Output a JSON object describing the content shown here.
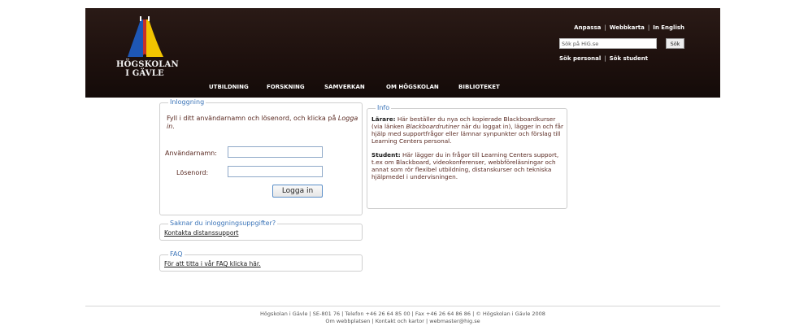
{
  "header": {
    "logo_text_line1": "HÖGSKOLAN",
    "logo_text_line2": "I GÄVLE",
    "top_links": [
      "Anpassa",
      "Webbkarta",
      "In English"
    ],
    "search": {
      "value": "Sök på HiG.se",
      "button_label": "Sök"
    },
    "search_links": [
      "Sök personal",
      "Sök student"
    ],
    "nav": [
      "UTBILDNING",
      "FORSKNING",
      "SAMVERKAN",
      "OM HÖGSKOLAN",
      "BIBLIOTEKET"
    ]
  },
  "login": {
    "legend": "Inloggning",
    "intro_prefix": "Fyll i ditt användarnamn och lösenord, och klicka på ",
    "intro_em": "Logga in",
    "intro_suffix": ".",
    "username_label": "Användarnamn:",
    "password_label": "Lösenord:",
    "button_label": "Logga in"
  },
  "info": {
    "legend": "Info",
    "teacher_heading": "Lärare:",
    "teacher_text_1": " Här beställer du nya och kopierade Blackboardkurser (via länken ",
    "teacher_em": "Blackboardrutiner",
    "teacher_text_2": " när du loggat in), lägger in och får hjälp med supportfrågor eller lämnar synpunkter och förslag till Learning Centers personal.",
    "student_heading": "Student:",
    "student_text": " Här lägger du in frågor till Learning Centers support, t.ex om Blackboard, videokonferenser, webbföreläsningar och annat som rör flexibel utbildning, distanskurser och tekniska hjälpmedel i undervisningen."
  },
  "missing": {
    "legend": "Saknar du inloggningsuppgifter?",
    "link": "Kontakta distanssupport"
  },
  "faq": {
    "legend": "FAQ",
    "link": "För att titta i vår FAQ klicka här."
  },
  "footer": {
    "line1": "Högskolan i Gävle | SE-801 76 | Telefon +46 26 64 85 00 | Fax +46 26 64 86 86 | © Högskolan i Gävle 2008",
    "line2": "Om webbplatsen | Kontakt och kartor | webmaster@hig.se"
  },
  "colors": {
    "header_bg": "#1d100d",
    "legend": "#3b74b8",
    "text": "#5a2a22",
    "logo_blue": "#1e57b5",
    "logo_yellow": "#f2c400"
  }
}
